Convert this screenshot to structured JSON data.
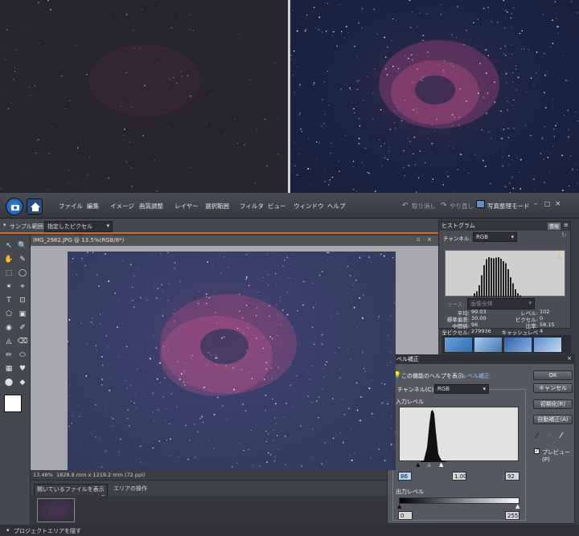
{
  "menu": {
    "items": [
      "ファイル",
      "編集",
      "イメージ",
      "画質調整",
      "レイヤー",
      "選択範囲",
      "フィルタ",
      "ビュー",
      "ウィンドウ",
      "ヘルプ"
    ],
    "undo_label": "取り消し",
    "redo_label": "やり直し",
    "organizer_label": "写真整理モード"
  },
  "options": {
    "sample_label": "サンプル範囲:",
    "sample_value": "指定したピクセル"
  },
  "document": {
    "tab_title": "IMG_2982.JPG @ 13.5%(RGB/8*)",
    "zoom": "13.48%",
    "size_info": "1828.8 mm x 1219.2 mm (72 ppi)"
  },
  "bin": {
    "show_label": "開いているファイルを表示",
    "area_label": "エリアの操作",
    "project_toggle": "プロジェクトエリアを隠す"
  },
  "histogram": {
    "title": "ヒストグラム",
    "tab_info": "情報",
    "channel_label": "チャンネル:",
    "channel_value": "RGB",
    "source_label": "ソース:",
    "source_value": "画像全体",
    "stats_left": [
      {
        "label": "平均:",
        "value": "99.03"
      },
      {
        "label": "標準偏差:",
        "value": "30.00"
      },
      {
        "label": "中間値:",
        "value": "96"
      },
      {
        "label": "全ピクセル:",
        "value": "279936"
      }
    ],
    "stats_right": [
      {
        "label": "レベル:",
        "value": "102"
      },
      {
        "label": "ピクセル:",
        "value": "0"
      },
      {
        "label": "比率:",
        "value": "58.15"
      },
      {
        "label": "キャッシュレベル:",
        "value": "4"
      }
    ],
    "bars": [
      0.1,
      0.15,
      0.3,
      0.55,
      0.8,
      0.95,
      1.0,
      0.98,
      0.97,
      0.99,
      1.0,
      0.96,
      0.9,
      0.85,
      0.7,
      0.5,
      0.35,
      0.2,
      0.1,
      0.05
    ]
  },
  "levels": {
    "title": "レベル補正",
    "help_text": "この機能のヘルプを表示:",
    "help_link": "レベル補正",
    "channel_label": "チャンネル(C):",
    "channel_value": "RGB",
    "input_label": "入力レベル",
    "input_black": "86",
    "input_gamma": "1.00",
    "input_white": "92",
    "output_label": "出力レベル",
    "output_black": "0",
    "output_white": "255",
    "ok_label": "OK",
    "cancel_label": "キャンセル",
    "reset_label": "初期化(R)",
    "auto_label": "自動補正(A)",
    "preview_label": "プレビュー(P)"
  }
}
